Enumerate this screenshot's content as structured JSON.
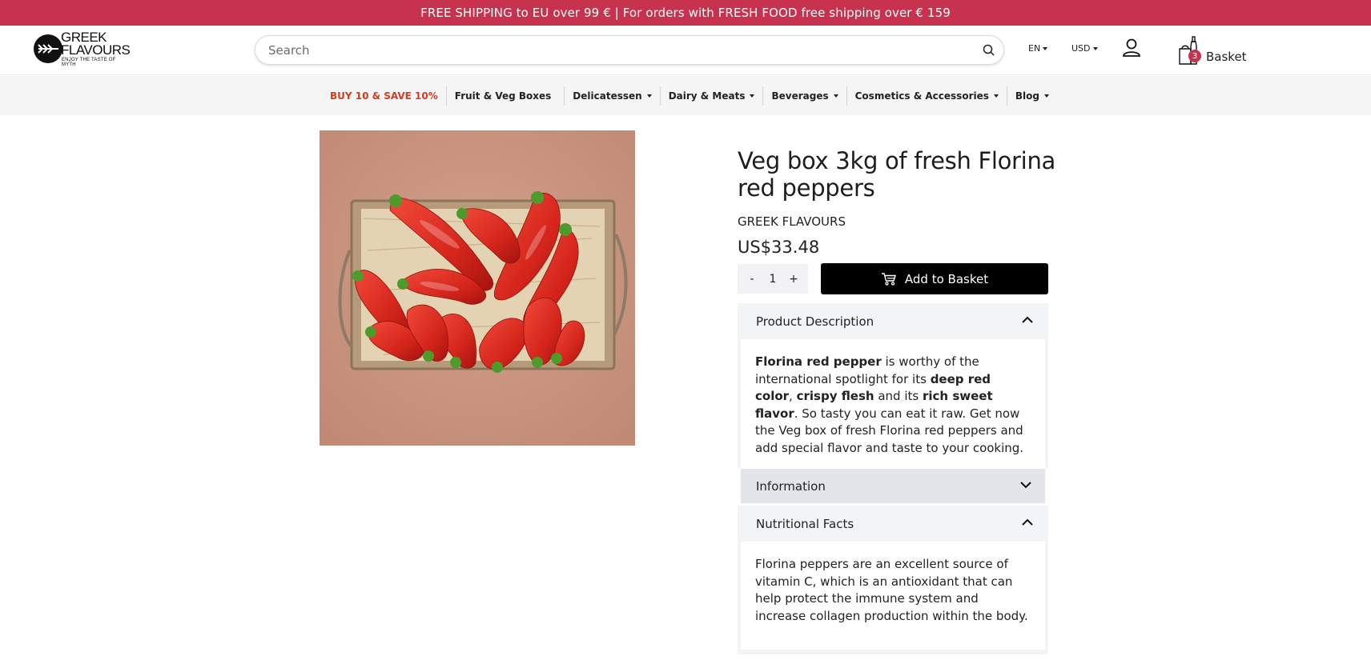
{
  "promo": {
    "text": "FREE SHIPPING to EU over 99 € | For orders with FRESH FOOD free shipping over € 159"
  },
  "header": {
    "logo": {
      "line1": "GREEK",
      "line2": "FLAVOURS",
      "tagline": "ENJOY THE TASTE OF MYTH"
    },
    "search": {
      "placeholder": "Search",
      "icon": "search-icon"
    },
    "language": "EN",
    "currency": "USD",
    "account_icon": "user-icon",
    "basket": {
      "count": "3",
      "label": "Basket",
      "icon": "basket-icon"
    }
  },
  "categories": [
    {
      "label": "BUY 10 & SAVE 10%",
      "has_dropdown": false,
      "highlight": true
    },
    {
      "label": "Fruit & Veg Boxes",
      "has_dropdown": false
    },
    {
      "label": "Delicatessen",
      "has_dropdown": true
    },
    {
      "label": "Dairy & Meats",
      "has_dropdown": true
    },
    {
      "label": "Beverages",
      "has_dropdown": true
    },
    {
      "label": "Cosmetics & Accessories",
      "has_dropdown": true
    },
    {
      "label": "Blog",
      "has_dropdown": true
    }
  ],
  "product": {
    "title": "Veg box 3kg of fresh Florina red peppers",
    "brand": "GREEK FLAVOURS",
    "price": "US$33.48",
    "quantity": {
      "minus": "-",
      "value": "1",
      "plus": "+"
    },
    "add_to_basket": "Add to Basket"
  },
  "accordions": {
    "description": {
      "title": "Product Description",
      "segments": [
        {
          "text": "Florina red pepper",
          "bold": true
        },
        {
          "text": " is worthy of the international spotlight for its ",
          "bold": false
        },
        {
          "text": "deep red color",
          "bold": true
        },
        {
          "text": ", ",
          "bold": false
        },
        {
          "text": "crispy flesh",
          "bold": true
        },
        {
          "text": " and its ",
          "bold": false
        },
        {
          "text": "rich sweet flavor",
          "bold": true
        },
        {
          "text": ". So tasty you can eat it raw. Get now the Veg box of fresh Florina red peppers and add special flavor and taste to your cooking.",
          "bold": false
        }
      ]
    },
    "information": {
      "title": "Information"
    },
    "nutrition": {
      "title": "Nutritional Facts",
      "body": "Florina peppers are an excellent source of vitamin C, which is an antioxidant that can help protect the immune system and increase collagen production within the body."
    }
  },
  "colors": {
    "promo_bar": "#c7334f",
    "promo_category": "#d63b1f",
    "button": "#000000",
    "image_bg": "#c99580"
  }
}
